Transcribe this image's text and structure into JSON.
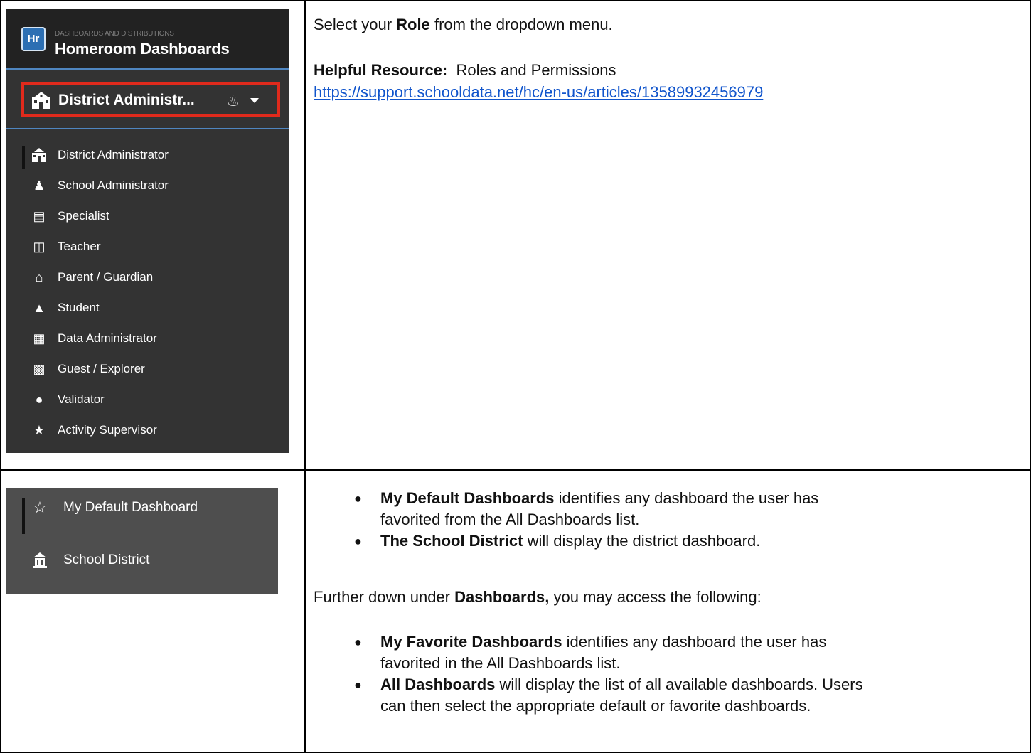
{
  "colors": {
    "app_dark": "#333333",
    "app_header": "#222222",
    "accent_blue": "#4f86c0",
    "highlight_red": "#e02a1c",
    "panel_gray": "#4e4e4e",
    "link": "#1155cc"
  },
  "app": {
    "logo": "Hr",
    "subtitle": "DASHBOARDS AND DISTRIBUTIONS",
    "title": "Homeroom Dashboards",
    "role_select": {
      "label": "District Administr...",
      "icon": "school-building-icon",
      "extra_icon": "notification-icon",
      "caret": "chevron-down-icon"
    },
    "roles": [
      {
        "label": "District Administrator",
        "icon": "school-building-icon",
        "active": true
      },
      {
        "label": "School Administrator",
        "icon": "podium-icon"
      },
      {
        "label": "Specialist",
        "icon": "document-search-icon"
      },
      {
        "label": "Teacher",
        "icon": "chalkboard-icon"
      },
      {
        "label": "Parent / Guardian",
        "icon": "home-heart-icon"
      },
      {
        "label": "Student",
        "icon": "graduation-cap-icon"
      },
      {
        "label": "Data Administrator",
        "icon": "id-card-icon"
      },
      {
        "label": "Guest / Explorer",
        "icon": "backpack-icon"
      },
      {
        "label": "Validator",
        "icon": "award-ribbon-icon"
      },
      {
        "label": "Activity Supervisor",
        "icon": "stars-icon"
      }
    ]
  },
  "row1": {
    "line1_pre": "Select your ",
    "line1_bold": "Role",
    "line1_post": " from the dropdown menu.",
    "resource_label": "Helpful Resource:",
    "resource_text": "Roles and Permissions",
    "resource_url": "https://support.schooldata.net/hc/en-us/articles/13589932456979"
  },
  "dash_panel": {
    "items": [
      {
        "label": "My Default Dashboard",
        "icon": "star-outline-icon",
        "active": true
      },
      {
        "label": "School District",
        "icon": "district-building-icon"
      }
    ]
  },
  "row2": {
    "bullets_a": [
      {
        "bold": "My Default Dashboards",
        "text1": " identifies any dashboard the user has",
        "text2": "favorited from the All Dashboards list."
      },
      {
        "bold": "The School District",
        "text1": " will display the district dashboard.",
        "text2": ""
      }
    ],
    "further_pre": "Further down under ",
    "further_bold": "Dashboards,",
    "further_post": " you may access the following:",
    "bullets_b": [
      {
        "bold": "My Favorite Dashboards",
        "text1": " identifies any dashboard the user has",
        "text2": "favorited in the All Dashboards list."
      },
      {
        "bold": "All Dashboards",
        "text1": " will display the list of all available dashboards.  Users",
        "text2": "can then select the appropriate default or favorite dashboards."
      }
    ]
  }
}
